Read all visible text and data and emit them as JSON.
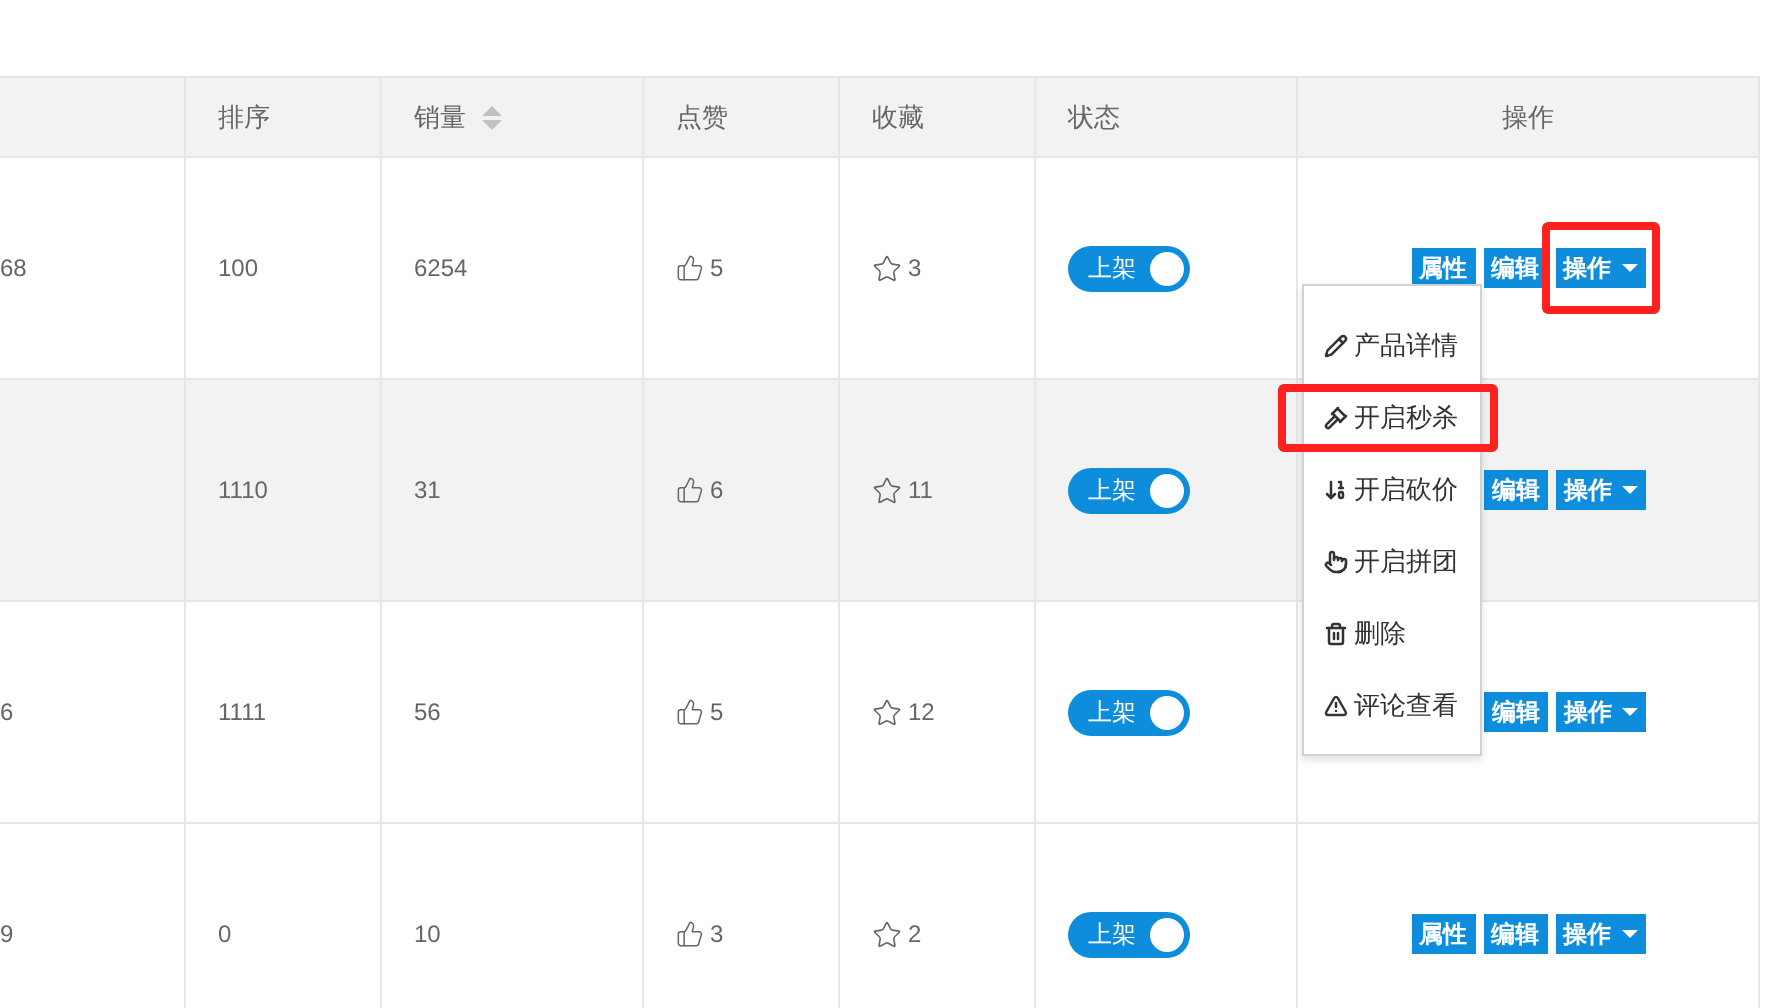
{
  "table": {
    "columns": [
      {},
      {
        "label": "排序"
      },
      {
        "label": "销量",
        "sortable": true
      },
      {
        "label": "点赞"
      },
      {
        "label": "收藏"
      },
      {
        "label": "状态"
      },
      {
        "label": "操作"
      }
    ],
    "rows": [
      {
        "column_1": "68",
        "sort": "100",
        "sales": "6254",
        "likes": "5",
        "favorites": "3",
        "status": {
          "label": "上架",
          "on": true
        },
        "hovered": false,
        "actions": [
          {
            "label": "属性",
            "kind": "button"
          },
          {
            "label": "编辑",
            "kind": "button"
          },
          {
            "label": "操作",
            "kind": "dropdown",
            "highlighted": true
          }
        ]
      },
      {
        "sort": "1110",
        "sales": "31",
        "likes": "6",
        "favorites": "11",
        "status": {
          "label": "上架",
          "on": true
        },
        "hovered": true,
        "actions": [
          {
            "label": "编辑",
            "kind": "button"
          },
          {
            "label": "操作",
            "kind": "dropdown",
            "highlighted": false
          }
        ]
      },
      {
        "column_1": "6",
        "sort": "1111",
        "sales": "56",
        "likes": "5",
        "favorites": "12",
        "status": {
          "label": "上架",
          "on": true
        },
        "hovered": false,
        "actions": [
          {
            "label": "编辑",
            "kind": "button"
          },
          {
            "label": "操作",
            "kind": "dropdown",
            "highlighted": false
          }
        ]
      },
      {
        "column_1": "9",
        "sort": "0",
        "sales": "10",
        "likes": "3",
        "favorites": "2",
        "status": {
          "label": "上架",
          "on": true
        },
        "hovered": false,
        "actions": [
          {
            "label": "属性",
            "kind": "button"
          },
          {
            "label": "编辑",
            "kind": "button"
          },
          {
            "label": "操作",
            "kind": "dropdown",
            "highlighted": false
          }
        ]
      }
    ]
  },
  "dropdown_menu": {
    "items": [
      {
        "label": "产品详情",
        "kind": "pencil",
        "highlighted": false
      },
      {
        "label": "开启秒杀",
        "kind": "gavel",
        "highlighted": true
      },
      {
        "label": "开启砍价",
        "kind": "sort",
        "highlighted": false
      },
      {
        "label": "开启拼团",
        "kind": "hand",
        "highlighted": false
      },
      {
        "label": "删除",
        "kind": "trash",
        "highlighted": false
      },
      {
        "label": "评论查看",
        "kind": "warning",
        "highlighted": false
      }
    ]
  }
}
